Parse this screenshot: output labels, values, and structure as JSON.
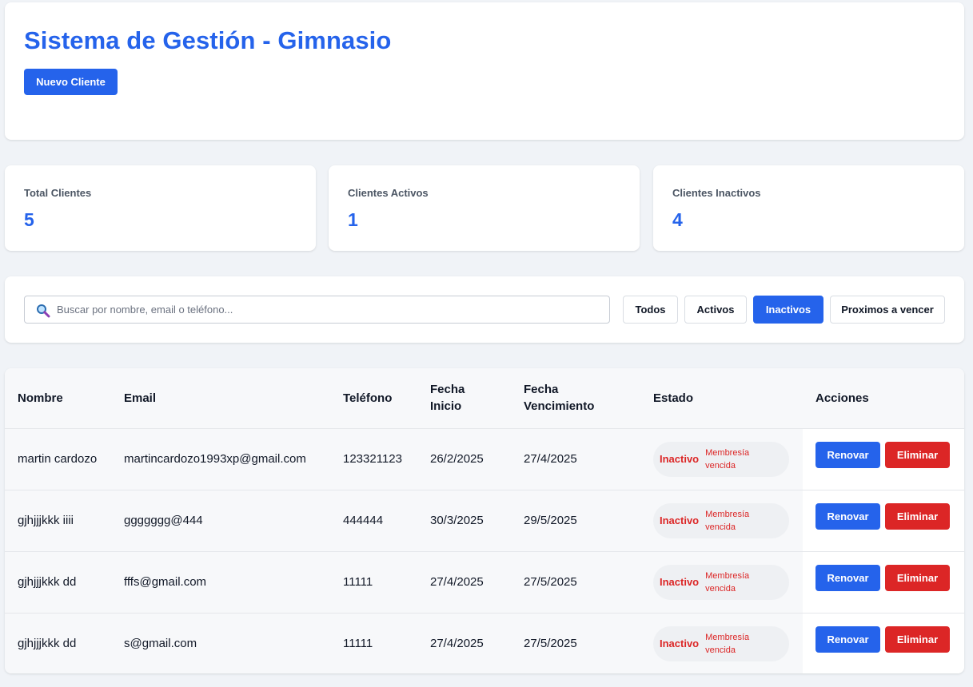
{
  "header": {
    "title": "Sistema de Gestión - Gimnasio",
    "new_client_label": "Nuevo Cliente"
  },
  "stats": [
    {
      "label": "Total Clientes",
      "value": "5"
    },
    {
      "label": "Clientes Activos",
      "value": "1"
    },
    {
      "label": "Clientes Inactivos",
      "value": "4"
    }
  ],
  "search": {
    "placeholder": "Buscar por nombre, email o teléfono...",
    "value": ""
  },
  "filters": [
    {
      "label": "Todos",
      "active": false
    },
    {
      "label": "Activos",
      "active": false
    },
    {
      "label": "Inactivos",
      "active": true
    },
    {
      "label": "Proximos a vencer",
      "active": false
    }
  ],
  "table": {
    "columns": [
      "Nombre",
      "Email",
      "Teléfono",
      "Fecha Inicio",
      "Fecha Vencimiento",
      "Estado",
      "Acciones"
    ],
    "rows": [
      {
        "nombre": "martin cardozo",
        "email": "martincardozo1993xp@gmail.com",
        "telefono": "123321123",
        "inicio": "26/2/2025",
        "vencimiento": "27/4/2025",
        "estado": "Inactivo",
        "estado_detalle": "Membresía vencida"
      },
      {
        "nombre": "gjhjjjkkk iiii",
        "email": "ggggggg@444",
        "telefono": "444444",
        "inicio": "30/3/2025",
        "vencimiento": "29/5/2025",
        "estado": "Inactivo",
        "estado_detalle": "Membresía vencida"
      },
      {
        "nombre": "gjhjjjkkk dd",
        "email": "fffs@gmail.com",
        "telefono": "11111",
        "inicio": "27/4/2025",
        "vencimiento": "27/5/2025",
        "estado": "Inactivo",
        "estado_detalle": "Membresía vencida"
      },
      {
        "nombre": "gjhjjjkkk dd",
        "email": "s@gmail.com",
        "telefono": "11111",
        "inicio": "27/4/2025",
        "vencimiento": "27/5/2025",
        "estado": "Inactivo",
        "estado_detalle": "Membresía vencida"
      }
    ],
    "renew_label": "Renovar",
    "delete_label": "Eliminar"
  },
  "colors": {
    "accent": "#2563eb",
    "danger": "#dc2626",
    "background": "#f0f3f7"
  },
  "icons": {
    "search": "search-icon"
  }
}
